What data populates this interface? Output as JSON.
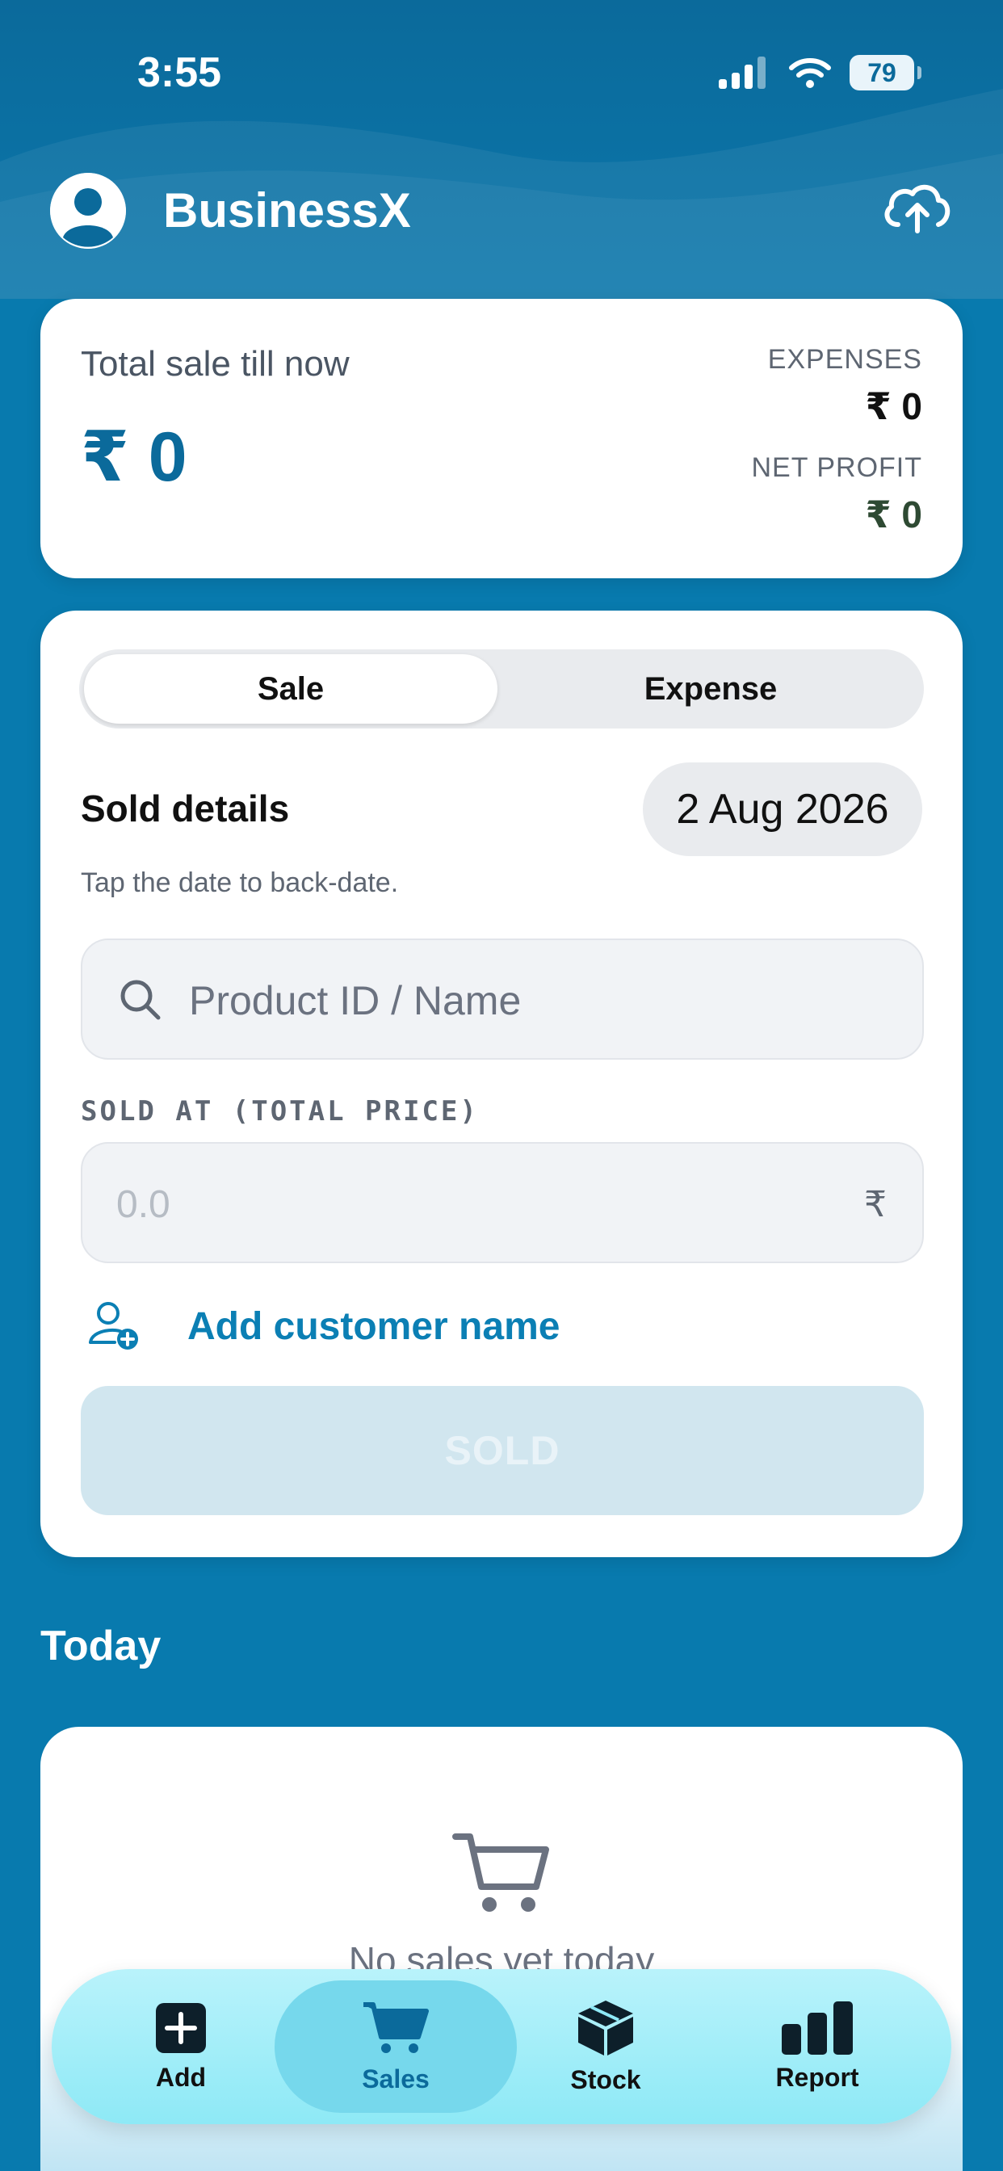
{
  "status_bar": {
    "time": "3:55",
    "battery": "79"
  },
  "header": {
    "title": "BusinessX",
    "avatar_icon": "user-circle-icon",
    "action_icon": "cloud-upload-icon"
  },
  "summary": {
    "total_label": "Total sale till now",
    "total_value": "₹ 0",
    "expenses_label": "EXPENSES",
    "expenses_value": "₹ 0",
    "net_profit_label": "NET PROFIT",
    "net_profit_value": "₹ 0"
  },
  "form": {
    "tabs": [
      {
        "label": "Sale",
        "active": true
      },
      {
        "label": "Expense",
        "active": false
      }
    ],
    "section_title": "Sold details",
    "date": "2 Aug 2026",
    "hint": "Tap the date to back-date.",
    "search_placeholder": "Product ID / Name",
    "price_label": "SOLD AT (TOTAL PRICE)",
    "price_placeholder": "0.0",
    "currency_symbol": "₹",
    "add_customer_label": "Add customer name",
    "submit_label": "SOLD"
  },
  "today": {
    "heading": "Today",
    "empty_text": "No sales yet today"
  },
  "nav": {
    "items": [
      {
        "label": "Add",
        "icon": "add-square-icon",
        "active": false
      },
      {
        "label": "Sales",
        "icon": "cart-icon",
        "active": true
      },
      {
        "label": "Stock",
        "icon": "box-icon",
        "active": false
      },
      {
        "label": "Report",
        "icon": "bar-chart-icon",
        "active": false
      }
    ]
  },
  "colors": {
    "background": "#087aae",
    "accent": "#0b6a9b",
    "link": "#0b7fb4",
    "nav_bg": "#8ee9f6",
    "net_profit": "#2e4a33"
  }
}
